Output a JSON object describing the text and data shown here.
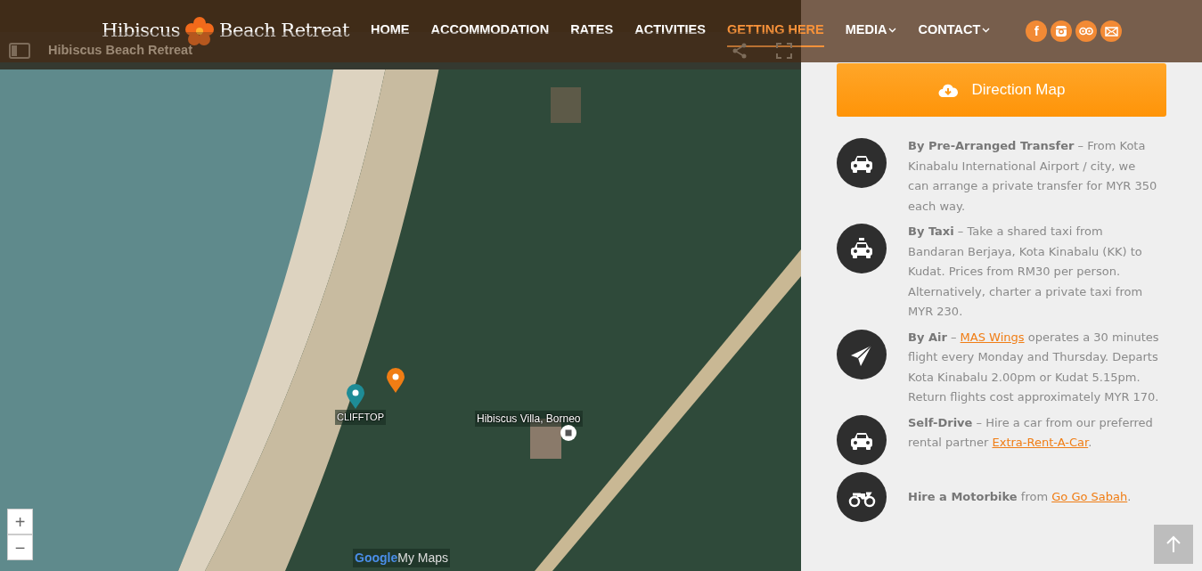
{
  "header": {
    "logo": {
      "left": "Hibiscus",
      "right": "Beach Retreat"
    },
    "nav": [
      {
        "label": "HOME",
        "selected": false,
        "dropdown": false
      },
      {
        "label": "ACCOMMODATION",
        "selected": false,
        "dropdown": false
      },
      {
        "label": "RATES",
        "selected": false,
        "dropdown": false
      },
      {
        "label": "ACTIVITIES",
        "selected": false,
        "dropdown": false
      },
      {
        "label": "GETTING HERE",
        "selected": true,
        "dropdown": false
      },
      {
        "label": "MEDIA",
        "selected": false,
        "dropdown": true
      },
      {
        "label": "CONTACT",
        "selected": false,
        "dropdown": true
      }
    ],
    "social": [
      {
        "kind": "facebook",
        "label": "f"
      },
      {
        "kind": "instagram"
      },
      {
        "kind": "tripadvisor"
      },
      {
        "kind": "email"
      }
    ]
  },
  "map": {
    "title": "Hibiscus Beach Retreat",
    "pins": [
      {
        "label": "CLIFFTOP",
        "color": "#1e8c96"
      },
      {
        "color": "#f07d14"
      }
    ],
    "place_label": "Hibiscus Villa, Borneo",
    "zoom_in": "+",
    "zoom_out": "−",
    "brand": {
      "google": "Google",
      "product": "My Maps"
    }
  },
  "directions": {
    "button": "Direction Map",
    "items": [
      {
        "kind": "car",
        "parts": [
          {
            "kind": "bold",
            "text": "By Pre-Arranged Transfer"
          },
          {
            "kind": "plain",
            "text": " – From Kota Kinabalu International Airport / city, we can arrange a private transfer for MYR 350 each way."
          }
        ]
      },
      {
        "kind": "taxi",
        "parts": [
          {
            "kind": "bold",
            "text": "By Taxi"
          },
          {
            "kind": "plain",
            "text": " – Take a shared taxi from Bandaran Berjaya, Kota Kinabalu (KK) to Kudat. Prices from RM30 per person. Alternatively, charter a private taxi from MYR 230."
          }
        ]
      },
      {
        "kind": "plane",
        "parts": [
          {
            "kind": "bold",
            "text": "By Air"
          },
          {
            "kind": "plain",
            "text": " – "
          },
          {
            "kind": "link",
            "text": "MAS Wings"
          },
          {
            "kind": "plain",
            "text": " operates a 30 minutes flight every Monday and Thursday. Departs Kota Kinabalu 2.00pm or Kudat 5.15pm. Return flights cost approximately MYR 170."
          }
        ]
      },
      {
        "kind": "car",
        "parts": [
          {
            "kind": "bold",
            "text": "Self-Drive"
          },
          {
            "kind": "plain",
            "text": " – Hire a car from our preferred rental partner "
          },
          {
            "kind": "link",
            "text": "Extra-Rent-A-Car"
          },
          {
            "kind": "plain",
            "text": "."
          }
        ]
      },
      {
        "kind": "motorbike",
        "parts": [
          {
            "kind": "bold",
            "text": "Hire a Motorbike"
          },
          {
            "kind": "plain",
            "text": " from "
          },
          {
            "kind": "link",
            "text": "Go Go Sabah"
          },
          {
            "kind": "plain",
            "text": "."
          }
        ]
      }
    ]
  }
}
